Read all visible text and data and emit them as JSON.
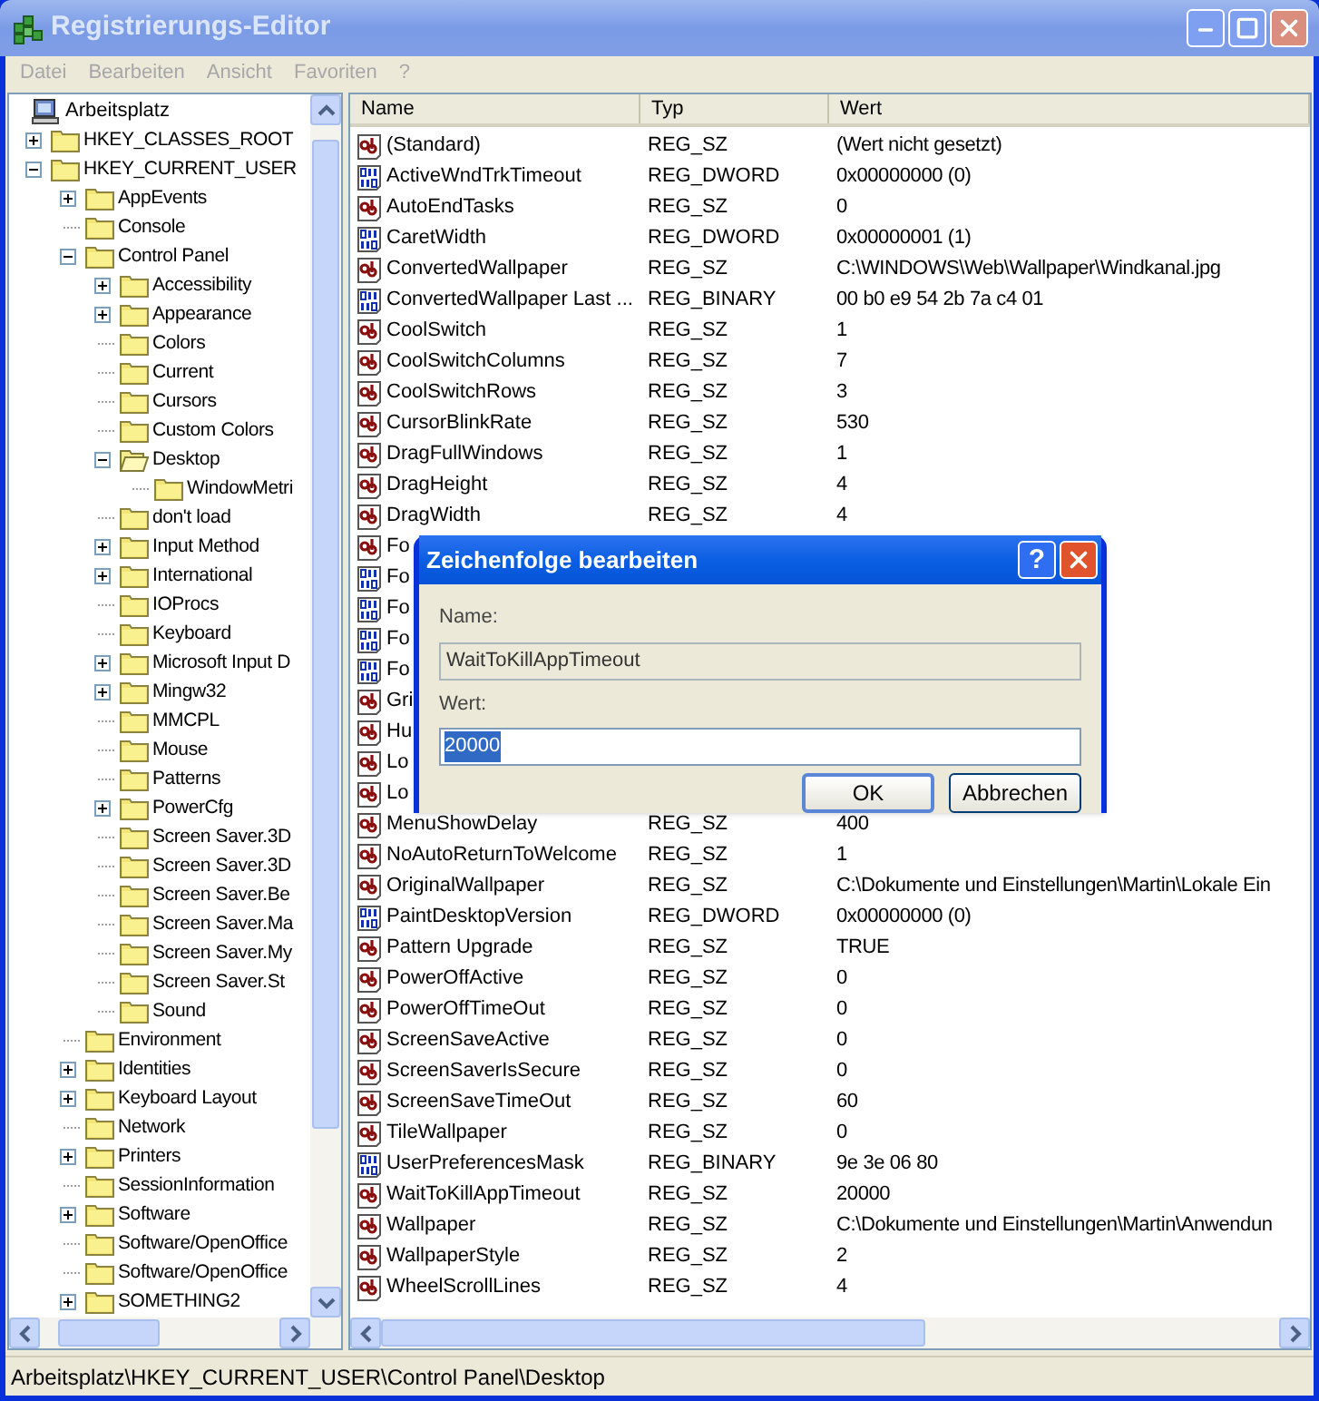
{
  "window": {
    "title": "Registrierungs-Editor"
  },
  "menu": [
    {
      "label": "Datei",
      "disabled": true
    },
    {
      "label": "Bearbeiten",
      "disabled": true
    },
    {
      "label": "Ansicht",
      "disabled": true
    },
    {
      "label": "Favoriten",
      "disabled": true
    },
    {
      "label": "?",
      "disabled": true
    }
  ],
  "tree": {
    "root": "Arbeitsplatz",
    "items": [
      {
        "label": "HKEY_CLASSES_ROOT",
        "kind": "plus",
        "selected": false
      },
      {
        "label": "HKEY_CURRENT_USER",
        "kind": "minus",
        "selected": false,
        "children": [
          {
            "label": "AppEvents",
            "kind": "plus",
            "selected": false
          },
          {
            "label": "Console",
            "kind": "leaf",
            "selected": false
          },
          {
            "label": "Control Panel",
            "kind": "minus",
            "selected": false,
            "children": [
              {
                "label": "Accessibility",
                "kind": "plus",
                "selected": false
              },
              {
                "label": "Appearance",
                "kind": "plus",
                "selected": false
              },
              {
                "label": "Colors",
                "kind": "leaf",
                "selected": false
              },
              {
                "label": "Current",
                "kind": "leaf",
                "selected": false
              },
              {
                "label": "Cursors",
                "kind": "leaf",
                "selected": false
              },
              {
                "label": "Custom Colors",
                "kind": "leaf",
                "selected": false
              },
              {
                "label": "Desktop",
                "kind": "minus",
                "selected": true,
                "children": [
                  {
                    "label": "WindowMetri",
                    "kind": "leaf",
                    "selected": false
                  }
                ]
              },
              {
                "label": "don't load",
                "kind": "leaf",
                "selected": false
              },
              {
                "label": "Input Method",
                "kind": "plus",
                "selected": false
              },
              {
                "label": "International",
                "kind": "plus",
                "selected": false
              },
              {
                "label": "IOProcs",
                "kind": "leaf",
                "selected": false
              },
              {
                "label": "Keyboard",
                "kind": "leaf",
                "selected": false
              },
              {
                "label": "Microsoft Input D",
                "kind": "plus",
                "selected": false
              },
              {
                "label": "Mingw32",
                "kind": "plus",
                "selected": false
              },
              {
                "label": "MMCPL",
                "kind": "leaf",
                "selected": false
              },
              {
                "label": "Mouse",
                "kind": "leaf",
                "selected": false
              },
              {
                "label": "Patterns",
                "kind": "leaf",
                "selected": false
              },
              {
                "label": "PowerCfg",
                "kind": "plus",
                "selected": false
              },
              {
                "label": "Screen Saver.3D",
                "kind": "leaf",
                "selected": false
              },
              {
                "label": "Screen Saver.3D",
                "kind": "leaf",
                "selected": false
              },
              {
                "label": "Screen Saver.Be",
                "kind": "leaf",
                "selected": false
              },
              {
                "label": "Screen Saver.Ma",
                "kind": "leaf",
                "selected": false
              },
              {
                "label": "Screen Saver.My",
                "kind": "leaf",
                "selected": false
              },
              {
                "label": "Screen Saver.St",
                "kind": "leaf",
                "selected": false
              },
              {
                "label": "Sound",
                "kind": "leaf",
                "selected": false
              }
            ]
          },
          {
            "label": "Environment",
            "kind": "leaf",
            "selected": false
          },
          {
            "label": "Identities",
            "kind": "plus",
            "selected": false
          },
          {
            "label": "Keyboard Layout",
            "kind": "plus",
            "selected": false
          },
          {
            "label": "Network",
            "kind": "leaf",
            "selected": false
          },
          {
            "label": "Printers",
            "kind": "plus",
            "selected": false
          },
          {
            "label": "SessionInformation",
            "kind": "leaf",
            "selected": false
          },
          {
            "label": "Software",
            "kind": "plus",
            "selected": false
          },
          {
            "label": "Software/OpenOffice",
            "kind": "leaf",
            "selected": false
          },
          {
            "label": "Software/OpenOffice",
            "kind": "leaf",
            "selected": false
          },
          {
            "label": "SOMETHING2",
            "kind": "plus",
            "selected": false
          }
        ]
      }
    ]
  },
  "values": {
    "columns": [
      "Name",
      "Typ",
      "Wert"
    ],
    "rows": [
      {
        "kind": "string",
        "name": "(Standard)",
        "type": "REG_SZ",
        "value": "(Wert nicht gesetzt)"
      },
      {
        "kind": "binary",
        "name": "ActiveWndTrkTimeout",
        "type": "REG_DWORD",
        "value": "0x00000000 (0)"
      },
      {
        "kind": "string",
        "name": "AutoEndTasks",
        "type": "REG_SZ",
        "value": "0"
      },
      {
        "kind": "binary",
        "name": "CaretWidth",
        "type": "REG_DWORD",
        "value": "0x00000001 (1)"
      },
      {
        "kind": "string",
        "name": "ConvertedWallpaper",
        "type": "REG_SZ",
        "value": "C:\\WINDOWS\\Web\\Wallpaper\\Windkanal.jpg"
      },
      {
        "kind": "binary",
        "name": "ConvertedWallpaper Last ...",
        "type": "REG_BINARY",
        "value": "00 b0 e9 54 2b 7a c4 01"
      },
      {
        "kind": "string",
        "name": "CoolSwitch",
        "type": "REG_SZ",
        "value": "1"
      },
      {
        "kind": "string",
        "name": "CoolSwitchColumns",
        "type": "REG_SZ",
        "value": "7"
      },
      {
        "kind": "string",
        "name": "CoolSwitchRows",
        "type": "REG_SZ",
        "value": "3"
      },
      {
        "kind": "string",
        "name": "CursorBlinkRate",
        "type": "REG_SZ",
        "value": "530"
      },
      {
        "kind": "string",
        "name": "DragFullWindows",
        "type": "REG_SZ",
        "value": "1"
      },
      {
        "kind": "string",
        "name": "DragHeight",
        "type": "REG_SZ",
        "value": "4"
      },
      {
        "kind": "string",
        "name": "DragWidth",
        "type": "REG_SZ",
        "value": "4"
      },
      {
        "kind": "string",
        "name": "Fo"
      },
      {
        "kind": "binary",
        "name": "Fo"
      },
      {
        "kind": "binary",
        "name": "Fo"
      },
      {
        "kind": "binary",
        "name": "Fo"
      },
      {
        "kind": "binary",
        "name": "Fo"
      },
      {
        "kind": "string",
        "name": "Gri"
      },
      {
        "kind": "string",
        "name": "Hu"
      },
      {
        "kind": "string",
        "name": "Lo"
      },
      {
        "kind": "string",
        "name": "Lo"
      },
      {
        "kind": "string",
        "name": "MenuShowDelay",
        "type": "REG_SZ",
        "value": "400"
      },
      {
        "kind": "string",
        "name": "NoAutoReturnToWelcome",
        "type": "REG_SZ",
        "value": "1"
      },
      {
        "kind": "string",
        "name": "OriginalWallpaper",
        "type": "REG_SZ",
        "value": "C:\\Dokumente und Einstellungen\\Martin\\Lokale Ein"
      },
      {
        "kind": "binary",
        "name": "PaintDesktopVersion",
        "type": "REG_DWORD",
        "value": "0x00000000 (0)"
      },
      {
        "kind": "string",
        "name": "Pattern Upgrade",
        "type": "REG_SZ",
        "value": "TRUE"
      },
      {
        "kind": "string",
        "name": "PowerOffActive",
        "type": "REG_SZ",
        "value": "0"
      },
      {
        "kind": "string",
        "name": "PowerOffTimeOut",
        "type": "REG_SZ",
        "value": "0"
      },
      {
        "kind": "string",
        "name": "ScreenSaveActive",
        "type": "REG_SZ",
        "value": "0"
      },
      {
        "kind": "string",
        "name": "ScreenSaverIsSecure",
        "type": "REG_SZ",
        "value": "0"
      },
      {
        "kind": "string",
        "name": "ScreenSaveTimeOut",
        "type": "REG_SZ",
        "value": "60"
      },
      {
        "kind": "string",
        "name": "TileWallpaper",
        "type": "REG_SZ",
        "value": "0"
      },
      {
        "kind": "binary",
        "name": "UserPreferencesMask",
        "type": "REG_BINARY",
        "value": "9e 3e 06 80"
      },
      {
        "kind": "string",
        "name": "WaitToKillAppTimeout",
        "type": "REG_SZ",
        "value": "20000"
      },
      {
        "kind": "string",
        "name": "Wallpaper",
        "type": "REG_SZ",
        "value": "C:\\Dokumente und Einstellungen\\Martin\\Anwendun"
      },
      {
        "kind": "string",
        "name": "WallpaperStyle",
        "type": "REG_SZ",
        "value": "2"
      },
      {
        "kind": "string",
        "name": "WheelScrollLines",
        "type": "REG_SZ",
        "value": "4"
      }
    ]
  },
  "dialog": {
    "title": "Zeichenfolge bearbeiten",
    "help_button": "?",
    "name_label": "Name:",
    "name_value": "WaitToKillAppTimeout",
    "value_label": "Wert:",
    "value": "20000",
    "value_selected": true,
    "buttons": [
      {
        "label": "OK",
        "default": true
      },
      {
        "label": "Abbrechen",
        "default": false
      }
    ]
  },
  "status_bar": "Arbeitsplatz\\HKEY_CURRENT_USER\\Control Panel\\Desktop"
}
